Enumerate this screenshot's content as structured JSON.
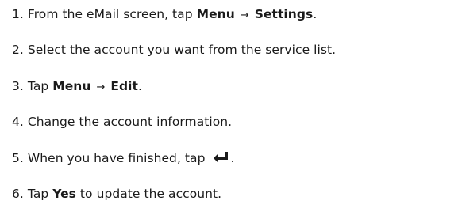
{
  "instructions": {
    "steps": [
      {
        "number": "1.",
        "text_before": "From the eMail screen, tap ",
        "bold_1": "Menu",
        "arrow": "→",
        "bold_2": "Settings",
        "text_after": "."
      },
      {
        "number": "2.",
        "text": "Select the account you want from the service list."
      },
      {
        "number": "3.",
        "text_before": "Tap ",
        "bold_1": "Menu",
        "arrow": "→",
        "bold_2": "Edit",
        "text_after": "."
      },
      {
        "number": "4.",
        "text": "Change the account information."
      },
      {
        "number": "5.",
        "text_before": "When you have finished, tap ",
        "icon": "enter-return-icon",
        "text_after": "."
      },
      {
        "number": "6.",
        "text_before": "Tap ",
        "bold_1": "Yes",
        "text_after": " to update the account."
      }
    ]
  }
}
